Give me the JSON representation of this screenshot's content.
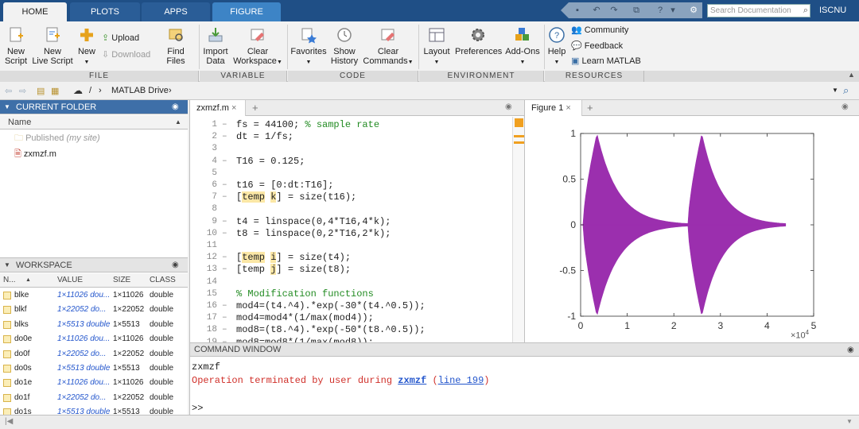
{
  "tabs": [
    "HOME",
    "PLOTS",
    "APPS",
    "FIGURE"
  ],
  "search_placeholder": "Search Documentation",
  "user": "ISCNU",
  "ribbon": {
    "file": {
      "new_script": "New\nScript",
      "new_live_script": "New\nLive Script",
      "new": "New",
      "upload": "Upload",
      "download": "Download",
      "find_files": "Find Files",
      "label": "FILE"
    },
    "variable": {
      "import_data": "Import\nData",
      "clear_workspace": "Clear\nWorkspace",
      "label": "VARIABLE"
    },
    "code": {
      "favorites": "Favorites",
      "show_history": "Show\nHistory",
      "clear_commands": "Clear\nCommands",
      "label": "CODE"
    },
    "environment": {
      "layout": "Layout",
      "preferences": "Preferences",
      "add_ons": "Add-Ons",
      "label": "ENVIRONMENT"
    },
    "resources": {
      "help": "Help",
      "community": "Community",
      "feedback": "Feedback",
      "learn": "Learn MATLAB",
      "label": "RESOURCES"
    }
  },
  "address": {
    "sep": "/",
    "path": "MATLAB Drive"
  },
  "current_folder": {
    "title": "CURRENT FOLDER",
    "col": "Name",
    "items": [
      {
        "name": "Published",
        "note": "(my site)"
      },
      {
        "name": "zxmzf.m"
      }
    ]
  },
  "workspace": {
    "title": "WORKSPACE",
    "cols": [
      "N...",
      "VALUE",
      "SIZE",
      "CLASS"
    ],
    "rows": [
      {
        "name": "blke",
        "value": "1×11026 dou...",
        "size": "1×11026",
        "class": "double"
      },
      {
        "name": "blkf",
        "value": "1×22052 do...",
        "size": "1×22052",
        "class": "double"
      },
      {
        "name": "blks",
        "value": "1×5513 double",
        "size": "1×5513",
        "class": "double"
      },
      {
        "name": "do0e",
        "value": "1×11026 dou...",
        "size": "1×11026",
        "class": "double"
      },
      {
        "name": "do0f",
        "value": "1×22052 do...",
        "size": "1×22052",
        "class": "double"
      },
      {
        "name": "do0s",
        "value": "1×5513 double",
        "size": "1×5513",
        "class": "double"
      },
      {
        "name": "do1e",
        "value": "1×11026 dou...",
        "size": "1×11026",
        "class": "double"
      },
      {
        "name": "do1f",
        "value": "1×22052 do...",
        "size": "1×22052",
        "class": "double"
      },
      {
        "name": "do1s",
        "value": "1×5513 double",
        "size": "1×5513",
        "class": "double"
      }
    ]
  },
  "editor": {
    "tab": "zxmzf.m",
    "lines": [
      {
        "n": "1",
        "d": "–",
        "pre": "fs = 44100; ",
        "hl": "",
        "mid": "",
        "hl2": "",
        "post": "",
        "cmt": "% sample rate"
      },
      {
        "n": "2",
        "d": "–",
        "pre": "dt = 1/fs;",
        "hl": "",
        "mid": "",
        "hl2": "",
        "post": "",
        "cmt": ""
      },
      {
        "n": "3",
        "d": "",
        "pre": "",
        "hl": "",
        "mid": "",
        "hl2": "",
        "post": "",
        "cmt": ""
      },
      {
        "n": "4",
        "d": "–",
        "pre": "T16 = 0.125;",
        "hl": "",
        "mid": "",
        "hl2": "",
        "post": "",
        "cmt": ""
      },
      {
        "n": "5",
        "d": "",
        "pre": "",
        "hl": "",
        "mid": "",
        "hl2": "",
        "post": "",
        "cmt": ""
      },
      {
        "n": "6",
        "d": "–",
        "pre": "t16 = [0:dt:T16];",
        "hl": "",
        "mid": "",
        "hl2": "",
        "post": "",
        "cmt": ""
      },
      {
        "n": "7",
        "d": "–",
        "pre": "[",
        "hl": "temp",
        "mid": " ",
        "hl2": "k",
        "post": "] = size(t16);",
        "cmt": ""
      },
      {
        "n": "8",
        "d": "",
        "pre": "",
        "hl": "",
        "mid": "",
        "hl2": "",
        "post": "",
        "cmt": ""
      },
      {
        "n": "9",
        "d": "–",
        "pre": "t4 = linspace(0,4*T16,4*k);",
        "hl": "",
        "mid": "",
        "hl2": "",
        "post": "",
        "cmt": ""
      },
      {
        "n": "10",
        "d": "–",
        "pre": "t8 = linspace(0,2*T16,2*k);",
        "hl": "",
        "mid": "",
        "hl2": "",
        "post": "",
        "cmt": ""
      },
      {
        "n": "11",
        "d": "",
        "pre": "",
        "hl": "",
        "mid": "",
        "hl2": "",
        "post": "",
        "cmt": ""
      },
      {
        "n": "12",
        "d": "–",
        "pre": "[",
        "hl": "temp",
        "mid": " ",
        "hl2": "i",
        "post": "] = size(t4);",
        "cmt": ""
      },
      {
        "n": "13",
        "d": "–",
        "pre": "[temp ",
        "hl": "",
        "mid": "",
        "hl2": "j",
        "post": "] = size(t8);",
        "cmt": ""
      },
      {
        "n": "14",
        "d": "",
        "pre": "",
        "hl": "",
        "mid": "",
        "hl2": "",
        "post": "",
        "cmt": ""
      },
      {
        "n": "15",
        "d": "",
        "pre": "",
        "hl": "",
        "mid": "",
        "hl2": "",
        "post": "",
        "cmt": "% Modification functions"
      },
      {
        "n": "16",
        "d": "–",
        "pre": "mod4=(t4.^4).*exp(-30*(t4.^0.5));",
        "hl": "",
        "mid": "",
        "hl2": "",
        "post": "",
        "cmt": ""
      },
      {
        "n": "17",
        "d": "–",
        "pre": "mod4=mod4*(1/max(mod4));",
        "hl": "",
        "mid": "",
        "hl2": "",
        "post": "",
        "cmt": ""
      },
      {
        "n": "18",
        "d": "–",
        "pre": "mod8=(t8.^4).*exp(-50*(t8.^0.5));",
        "hl": "",
        "mid": "",
        "hl2": "",
        "post": "",
        "cmt": ""
      },
      {
        "n": "19",
        "d": "–",
        "pre": "mod8=mod8*(1/max(mod8));",
        "hl": "",
        "mid": "",
        "hl2": "",
        "post": "",
        "cmt": ""
      }
    ]
  },
  "figure": {
    "tab": "Figure 1",
    "exp": "×10",
    "exp_sup": "4"
  },
  "chart_data": {
    "type": "line",
    "title": "",
    "xlabel": "",
    "ylabel": "",
    "xlim": [
      0,
      5
    ],
    "ylim": [
      -1,
      1
    ],
    "xticks": [
      "0",
      "1",
      "2",
      "3",
      "4",
      "5"
    ],
    "yticks": [
      "1",
      "0.5",
      "0",
      "-0.5",
      "-1"
    ],
    "color": "#9b2fae",
    "series": [
      {
        "shape": "decaying oscillation envelope",
        "bursts": [
          {
            "start": 0.05,
            "peak": 0.35,
            "end": 2.3
          },
          {
            "start": 2.3,
            "peak": 2.6,
            "end": 4.4
          }
        ],
        "amplitude": 1
      }
    ]
  },
  "command": {
    "title": "COMMAND WINDOW",
    "lines": [
      "zxmzf"
    ],
    "err_pre": "Operation terminated by user during ",
    "err_link": "zxmzf",
    "err_mid": " (",
    "err_link2": "line 199",
    "err_post": ")",
    "prompt": ">>"
  }
}
